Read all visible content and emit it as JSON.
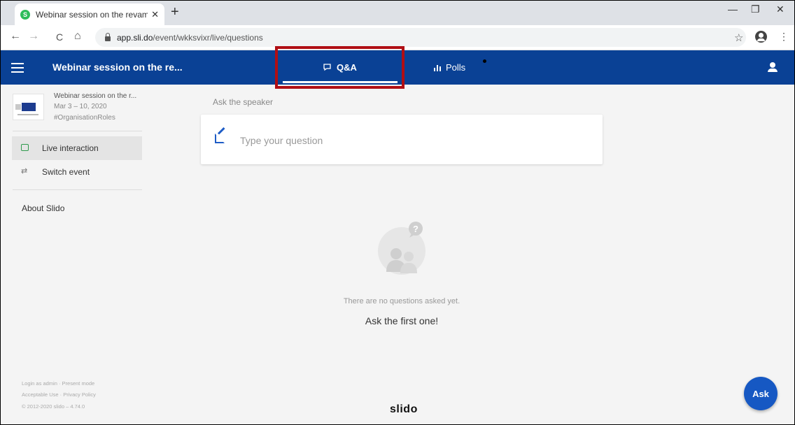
{
  "browser": {
    "tab_title": "Webinar session on the revampe",
    "tab_close": "✕",
    "new_tab": "+",
    "favicon_letter": "S",
    "url_domain": "app.sli.do",
    "url_path": "/event/wkksvixr/live/questions",
    "window_controls": [
      "—",
      "❐",
      "✕"
    ],
    "nav": {
      "back": "←",
      "forward": "→",
      "reload": "C",
      "home": "⌂"
    },
    "star": "☆",
    "menu": "⋮"
  },
  "header": {
    "title": "Webinar session on the re...",
    "tabs": {
      "qa": "Q&A",
      "polls": "Polls"
    },
    "brand_color": "#0a4195"
  },
  "sidebar": {
    "event_name": "Webinar session on the r...",
    "event_date": "Mar 3 – 10, 2020",
    "event_tag": "#OrganisationRoles",
    "items": [
      {
        "label": "Live interaction",
        "icon": "chat-icon"
      },
      {
        "label": "Switch event",
        "icon": "switch-arrows-icon"
      }
    ],
    "about": "About Slido",
    "footer": [
      "Login as admin · Present mode",
      "Acceptable Use · Privacy Policy",
      "© 2012-2020 slido – 4.74.0"
    ]
  },
  "main": {
    "ask_label": "Ask the speaker",
    "question_placeholder": "Type your question",
    "empty_message": "There are no questions asked yet.",
    "empty_cta": "Ask the first one!",
    "logo": "slido",
    "ask_button": "Ask",
    "ask_color": "#1658c3"
  }
}
